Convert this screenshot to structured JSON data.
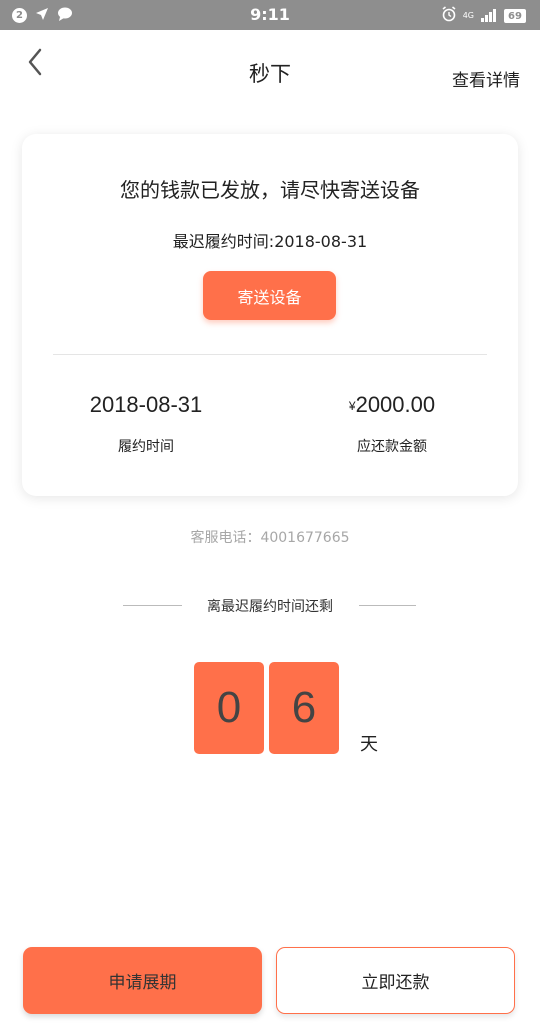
{
  "status_bar": {
    "notification_count": "2",
    "time": "9:11",
    "network_label": "4G",
    "battery": "69"
  },
  "header": {
    "title": "秒下",
    "details_link": "查看详情"
  },
  "card": {
    "message": "您的钱款已发放，请尽快寄送设备",
    "deadline": "最迟履约时间:2018-08-31",
    "send_button": "寄送设备",
    "date_value": "2018-08-31",
    "date_label": "履约时间",
    "currency_symbol": "¥",
    "amount_value": "2000.00",
    "amount_label": "应还款金额"
  },
  "service_phone": "客服电话：4001677665",
  "countdown": {
    "title": "离最迟履约时间还剩",
    "digits": [
      "0",
      "6"
    ],
    "unit": "天"
  },
  "buttons": {
    "extend": "申请展期",
    "repay": "立即还款"
  },
  "colors": {
    "accent": "#ff704a",
    "status_bar": "#8e8e8e",
    "muted_text": "#a7a7a7"
  }
}
